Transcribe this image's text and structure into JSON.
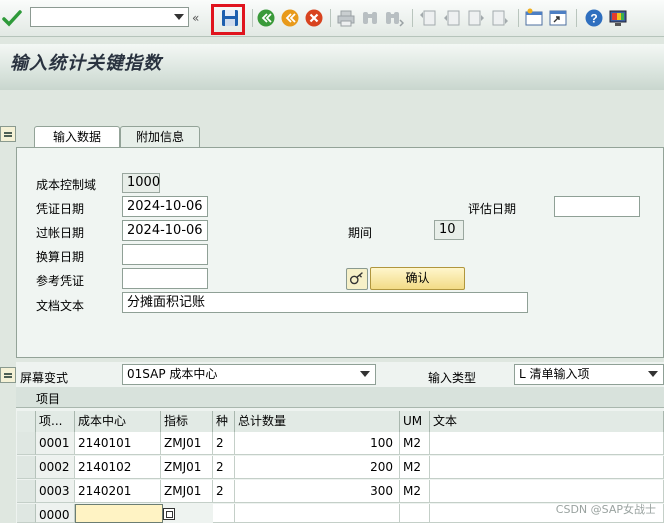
{
  "toolbar": {
    "command_field_value": "",
    "icons": [
      "check-icon",
      "save-icon",
      "back-icon",
      "exit-icon",
      "cancel-icon",
      "print-icon",
      "find-icon",
      "find-next-icon",
      "first-page-icon",
      "previous-page-icon",
      "next-page-icon",
      "last-page-icon",
      "create-session-icon",
      "shortcut-icon",
      "help-icon",
      "customize-layout-icon"
    ]
  },
  "title": "输入统计关键指数",
  "tabs": [
    "输入数据",
    "附加信息"
  ],
  "form": {
    "controlling_area_label": "成本控制域",
    "controlling_area_value": "1000",
    "document_date_label": "凭证日期",
    "document_date_value": "2024-10-06",
    "valuation_date_label": "评估日期",
    "valuation_date_value": "",
    "posting_date_label": "过帐日期",
    "posting_date_value": "2024-10-06",
    "period_label": "期间",
    "period_value": "10",
    "translation_date_label": "换算日期",
    "translation_date_value": "",
    "reference_label": "参考凭证",
    "reference_value": "",
    "confirm_label": "确认",
    "doc_text_label": "文档文本",
    "doc_text_value": "分摊面积记账"
  },
  "screen_variant": {
    "label": "屏幕变式",
    "value": "01SAP 成本中心",
    "input_type_label": "输入类型",
    "input_type_value": "L 清单输入项"
  },
  "grid": {
    "title": "项目",
    "columns": [
      "项...",
      "成本中心",
      "指标",
      "种",
      "总计数量",
      "UM",
      "文本"
    ],
    "rows": [
      {
        "item": "0001",
        "cost_center": "2140101",
        "skf": "ZMJ01",
        "cat": "2",
        "qty": "100",
        "um": "M2",
        "text": ""
      },
      {
        "item": "0002",
        "cost_center": "2140102",
        "skf": "ZMJ01",
        "cat": "2",
        "qty": "200",
        "um": "M2",
        "text": ""
      },
      {
        "item": "0003",
        "cost_center": "2140201",
        "skf": "ZMJ01",
        "cat": "2",
        "qty": "300",
        "um": "M2",
        "text": ""
      },
      {
        "item": "0000",
        "cost_center": "",
        "skf": "",
        "cat": "",
        "qty": "",
        "um": "",
        "text": ""
      }
    ]
  },
  "watermark": "CSDN @SAP女战士",
  "colors": {
    "highlight_box": "#e0141e",
    "check_green": "#2e9a3a",
    "save_blue": "#1d5fae",
    "back_green": "#3a9a3a",
    "exit_orange": "#e89a1a",
    "cancel_red": "#d8431f"
  }
}
